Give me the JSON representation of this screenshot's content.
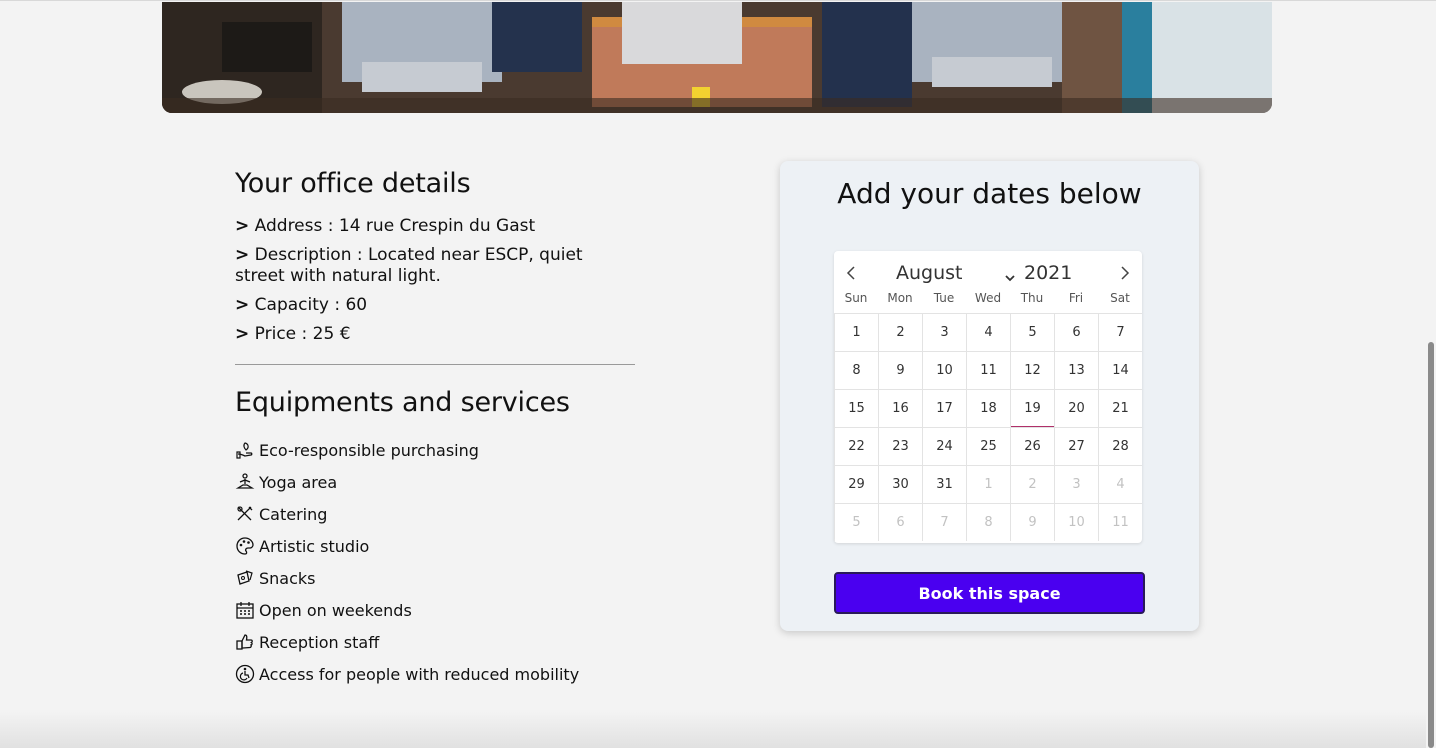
{
  "office": {
    "title": "Your office details",
    "details": [
      {
        "prefix": ">",
        "text": "Address : 14 rue Crespin du Gast"
      },
      {
        "prefix": ">",
        "text": "Description : Located near ESCP, quiet street with natural light."
      },
      {
        "prefix": ">",
        "text": "Capacity : 60"
      },
      {
        "prefix": ">",
        "text": "Price : 25 €"
      }
    ]
  },
  "equipment": {
    "title": "Equipments and services",
    "items": [
      {
        "label": "Eco-responsible purchasing",
        "icon": "eco-hand-icon"
      },
      {
        "label": "Yoga area",
        "icon": "yoga-icon"
      },
      {
        "label": "Catering",
        "icon": "catering-icon"
      },
      {
        "label": "Artistic studio",
        "icon": "palette-icon"
      },
      {
        "label": "Snacks",
        "icon": "snacks-icon"
      },
      {
        "label": "Open on weekends",
        "icon": "calendar-icon"
      },
      {
        "label": "Reception staff",
        "icon": "thumbs-up-icon"
      },
      {
        "label": "Access for people with reduced mobility",
        "icon": "wheelchair-icon"
      }
    ]
  },
  "booking": {
    "title": "Add your dates below",
    "button_label": "Book this space",
    "calendar": {
      "month": "August",
      "year": "2021",
      "weekdays": [
        "Sun",
        "Mon",
        "Tue",
        "Wed",
        "Thu",
        "Fri",
        "Sat"
      ],
      "today": "19",
      "days": [
        {
          "d": "1",
          "muted": false
        },
        {
          "d": "2",
          "muted": false
        },
        {
          "d": "3",
          "muted": false
        },
        {
          "d": "4",
          "muted": false
        },
        {
          "d": "5",
          "muted": false
        },
        {
          "d": "6",
          "muted": false
        },
        {
          "d": "7",
          "muted": false
        },
        {
          "d": "8",
          "muted": false
        },
        {
          "d": "9",
          "muted": false
        },
        {
          "d": "10",
          "muted": false
        },
        {
          "d": "11",
          "muted": false
        },
        {
          "d": "12",
          "muted": false
        },
        {
          "d": "13",
          "muted": false
        },
        {
          "d": "14",
          "muted": false
        },
        {
          "d": "15",
          "muted": false
        },
        {
          "d": "16",
          "muted": false
        },
        {
          "d": "17",
          "muted": false
        },
        {
          "d": "18",
          "muted": false
        },
        {
          "d": "19",
          "muted": false
        },
        {
          "d": "20",
          "muted": false
        },
        {
          "d": "21",
          "muted": false
        },
        {
          "d": "22",
          "muted": false
        },
        {
          "d": "23",
          "muted": false
        },
        {
          "d": "24",
          "muted": false
        },
        {
          "d": "25",
          "muted": false
        },
        {
          "d": "26",
          "muted": false
        },
        {
          "d": "27",
          "muted": false
        },
        {
          "d": "28",
          "muted": false
        },
        {
          "d": "29",
          "muted": false
        },
        {
          "d": "30",
          "muted": false
        },
        {
          "d": "31",
          "muted": false
        },
        {
          "d": "1",
          "muted": true
        },
        {
          "d": "2",
          "muted": true
        },
        {
          "d": "3",
          "muted": true
        },
        {
          "d": "4",
          "muted": true
        },
        {
          "d": "5",
          "muted": true
        },
        {
          "d": "6",
          "muted": true
        },
        {
          "d": "7",
          "muted": true
        },
        {
          "d": "8",
          "muted": true
        },
        {
          "d": "9",
          "muted": true
        },
        {
          "d": "10",
          "muted": true
        },
        {
          "d": "11",
          "muted": true
        }
      ]
    }
  },
  "colors": {
    "button_bg": "#4a00f0",
    "card_bg": "#edf1f5",
    "today_marker": "#b0306a"
  }
}
